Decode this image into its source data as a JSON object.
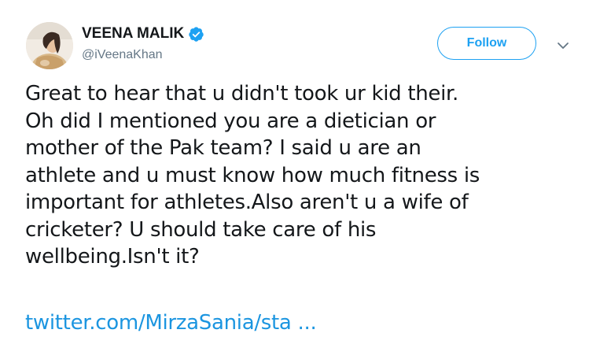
{
  "user": {
    "display_name": "VEENA MALIK",
    "handle": "@iVeenaKhan",
    "avatar_icon": "profile-photo",
    "verified_icon": "verified-badge-icon"
  },
  "actions": {
    "follow_label": "Follow",
    "more_icon": "chevron-down-icon"
  },
  "tweet": {
    "lines": [
      "Great to hear that u didn't took ur kid their.",
      "Oh did I mentioned you are a dietician or",
      "mother of the Pak team? I said u are an",
      "athlete and u must know how much fitness is",
      "important for athletes.Also aren't u a wife of",
      "cricketer? U should take care of his",
      "wellbeing.Isn't it?"
    ],
    "link_text": "twitter.com/MirzaSania/sta ..."
  },
  "colors": {
    "accent": "#1da1f2",
    "link": "#1b95e0",
    "text": "#14171a",
    "secondary": "#657786"
  }
}
